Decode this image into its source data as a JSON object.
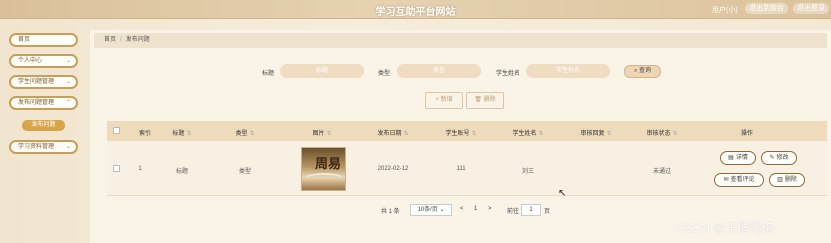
{
  "header": {
    "title": "学习互助平台网站",
    "user": "用户(小)",
    "exit_label": "退出到前台",
    "logout_label": "退出登录"
  },
  "sidebar": {
    "items": [
      {
        "label": "首页"
      },
      {
        "label": "个人中心"
      },
      {
        "label": "学生问题管理"
      },
      {
        "label": "发布问题管理"
      },
      {
        "label": "学习资料管理"
      }
    ],
    "active_sub": "发布问题"
  },
  "breadcrumb": {
    "home": "首页",
    "current": "发布问题"
  },
  "filters": {
    "title_label": "标题",
    "title_placeholder": "标题",
    "type_label": "类型",
    "type_placeholder": "类型",
    "student_label": "学生姓名",
    "student_placeholder": "学生姓名",
    "search_label": "查询"
  },
  "actions": {
    "add_label": "新增",
    "delete_label": "删除"
  },
  "table": {
    "columns": [
      "索引",
      "标题",
      "类型",
      "图片",
      "发布日期",
      "学生账号",
      "学生姓名",
      "审核回复",
      "审核状态",
      "操作"
    ],
    "rows": [
      {
        "index": "1",
        "title": "标题",
        "type": "类型",
        "image_text": "周易",
        "date": "2022-02-12",
        "account": "111",
        "name": "刘三",
        "reply": "",
        "status": "未通过",
        "ops": [
          "详情",
          "修改",
          "查看评论",
          "删除"
        ]
      }
    ]
  },
  "pagination": {
    "total": "共 1 条",
    "page_size": "10条/页",
    "prev": "<",
    "page": "1",
    "next": ">",
    "goto_label": "前往",
    "goto_value": "1",
    "page_unit": "页"
  },
  "watermark": "CSDN @王倩网络",
  "colors": {
    "accent": "#d8a54a",
    "header": "#dcc39d",
    "table_head": "#eedbbb"
  }
}
